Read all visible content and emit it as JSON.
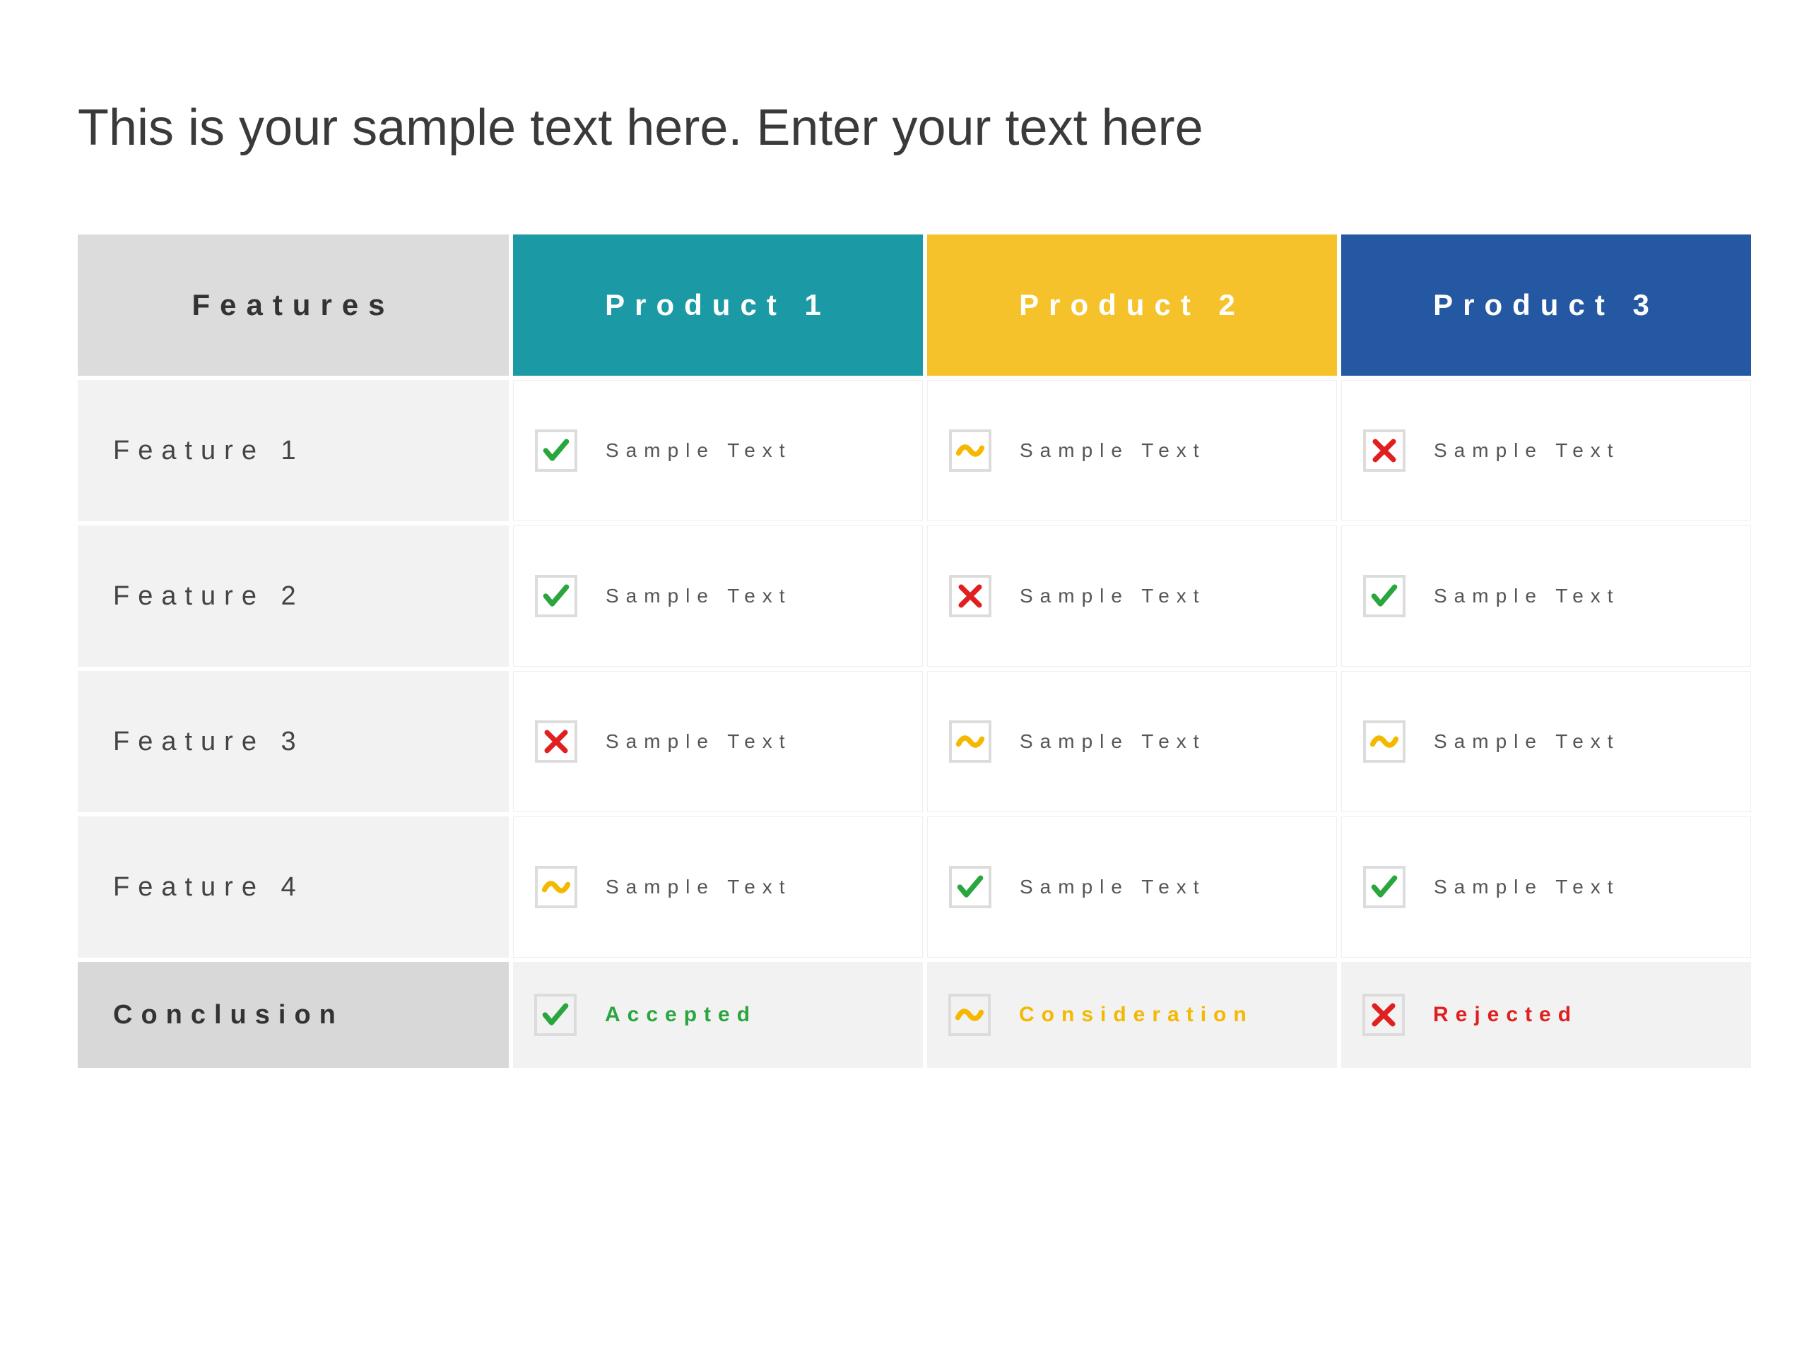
{
  "title": "This is your sample text here. Enter your text here",
  "headers": {
    "features": "Features",
    "p1": "Product 1",
    "p2": "Product 2",
    "p3": "Product 3"
  },
  "rows": [
    {
      "label": "Feature 1",
      "p1": {
        "status": "check",
        "text": "Sample Text"
      },
      "p2": {
        "status": "tilde",
        "text": "Sample Text"
      },
      "p3": {
        "status": "cross",
        "text": "Sample Text"
      }
    },
    {
      "label": "Feature 2",
      "p1": {
        "status": "check",
        "text": "Sample Text"
      },
      "p2": {
        "status": "cross",
        "text": "Sample Text"
      },
      "p3": {
        "status": "check",
        "text": "Sample Text"
      }
    },
    {
      "label": "Feature 3",
      "p1": {
        "status": "cross",
        "text": "Sample Text"
      },
      "p2": {
        "status": "tilde",
        "text": "Sample Text"
      },
      "p3": {
        "status": "tilde",
        "text": "Sample Text"
      }
    },
    {
      "label": "Feature 4",
      "p1": {
        "status": "tilde",
        "text": "Sample Text"
      },
      "p2": {
        "status": "check",
        "text": "Sample Text"
      },
      "p3": {
        "status": "check",
        "text": "Sample Text"
      }
    }
  ],
  "conclusion": {
    "label": "Conclusion",
    "p1": {
      "status": "check",
      "text": "Accepted",
      "color": "green"
    },
    "p2": {
      "status": "tilde",
      "text": "Consideration",
      "color": "yellow"
    },
    "p3": {
      "status": "cross",
      "text": "Rejected",
      "color": "red"
    }
  }
}
